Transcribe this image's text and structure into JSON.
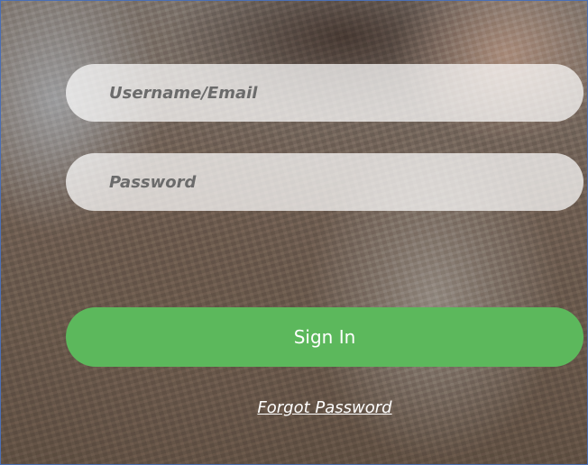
{
  "login": {
    "username_placeholder": "Username/Email",
    "username_value": "",
    "password_placeholder": "Password",
    "password_value": "",
    "signin_label": "Sign In",
    "forgot_label": "Forgot Password"
  },
  "colors": {
    "signin_button": "#5cb85c",
    "field_background": "rgba(255,255,255,0.72)",
    "frame_border": "#4a6fb5"
  }
}
